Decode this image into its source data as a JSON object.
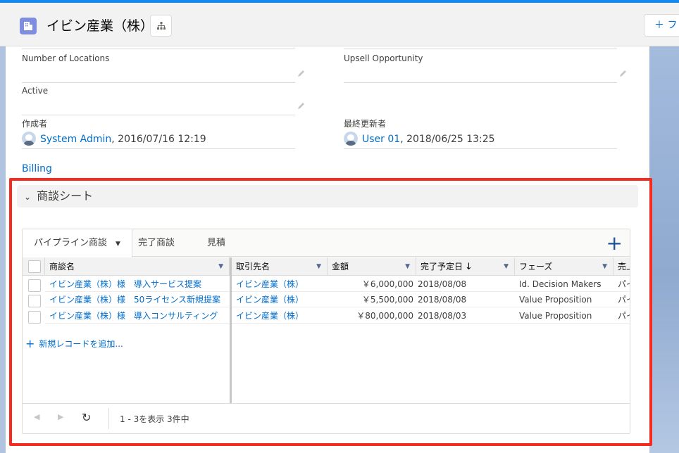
{
  "header": {
    "title": "イビン産業（株）",
    "follow_label": "＋ フ"
  },
  "fields": {
    "number_of_locations": {
      "label": "Number of Locations",
      "value": ""
    },
    "upsell_opportunity": {
      "label": "Upsell Opportunity",
      "value": ""
    },
    "active": {
      "label": "Active",
      "value": ""
    },
    "created_by": {
      "label": "作成者",
      "user": "System Admin",
      "datetime": ", 2016/07/16 12:19"
    },
    "last_modified_by": {
      "label": "最終更新者",
      "user": "User 01",
      "datetime": ", 2018/06/25 13:25"
    }
  },
  "billing_label": "Billing",
  "section": {
    "title": "商談シート",
    "tabs": [
      {
        "label": "パイプライン商談"
      },
      {
        "label": "完了商談"
      },
      {
        "label": "見積"
      }
    ],
    "columns": {
      "name": "商談名",
      "account": "取引先名",
      "amount": "金額",
      "close_date": "完了予定日",
      "stage": "フェーズ",
      "extra": "売上"
    },
    "rows": [
      {
        "name": "イビン産業（株）様　導入サービス提案",
        "account": "イビン産業（株）",
        "amount": "￥6,000,000",
        "close_date": "2018/08/08",
        "stage": "Id. Decision Makers",
        "extra": "パイ"
      },
      {
        "name": "イビン産業（株）様　50ライセンス新規提案",
        "account": "イビン産業（株）",
        "amount": "￥5,500,000",
        "close_date": "2018/08/08",
        "stage": "Value Proposition",
        "extra": "パイ"
      },
      {
        "name": "イビン産業（株）様　導入コンサルティング",
        "account": "イビン産業（株）",
        "amount": "￥80,000,000",
        "close_date": "2018/08/03",
        "stage": "Value Proposition",
        "extra": "パイ"
      }
    ],
    "add_record_label": "新規レコードを追加...",
    "pager_text": "1 - 3を表示 3件中"
  },
  "colors": {
    "accent": "#0070d2",
    "highlight_border": "#f72a1f",
    "record_icon": "#7f8de1"
  },
  "icons": [
    "record-icon",
    "hierarchy-icon",
    "pencil-icon",
    "chevron-down-icon",
    "plus-icon",
    "sort-arrow-icon",
    "refresh-icon",
    "prev-icon",
    "next-icon"
  ]
}
